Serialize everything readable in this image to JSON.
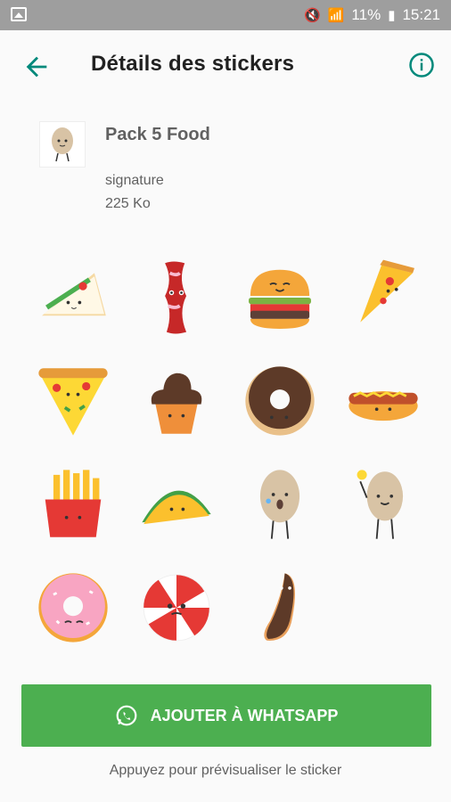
{
  "status_bar": {
    "battery": "11%",
    "time": "15:21"
  },
  "app_bar": {
    "title": "Détails des stickers"
  },
  "pack": {
    "name": "Pack 5 Food",
    "publisher": "signature",
    "size": "225 Ko"
  },
  "stickers": [
    {
      "name": "sandwich"
    },
    {
      "name": "bacon"
    },
    {
      "name": "burger"
    },
    {
      "name": "pizza-slice"
    },
    {
      "name": "pizza-slice-2"
    },
    {
      "name": "cupcake"
    },
    {
      "name": "chocolate-donut"
    },
    {
      "name": "hot-dog"
    },
    {
      "name": "fries"
    },
    {
      "name": "taco"
    },
    {
      "name": "sick-egg"
    },
    {
      "name": "idea-egg"
    },
    {
      "name": "pink-donut"
    },
    {
      "name": "peppermint-candy"
    },
    {
      "name": "eclair"
    }
  ],
  "actions": {
    "add_label": "AJOUTER À WHATSAPP",
    "hint": "Appuyez pour prévisualiser le sticker"
  },
  "colors": {
    "accent": "#00897b",
    "button": "#4caf50",
    "status_bar": "#9e9e9e"
  }
}
